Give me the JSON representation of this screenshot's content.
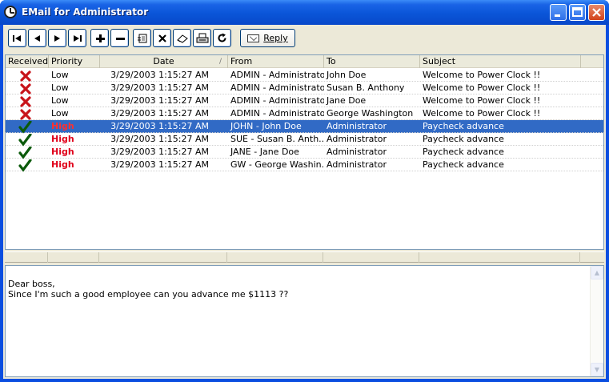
{
  "window": {
    "title": "EMail for Administrator"
  },
  "toolbar": {
    "first": "|◀",
    "prev": "◀",
    "next": "▶",
    "last": "▶|",
    "add": "+",
    "remove": "−",
    "edit": "✎",
    "delete": "✕",
    "clear": "◇",
    "print": "▤",
    "refresh": "↻",
    "reply_label": "Reply"
  },
  "columns": [
    "Received",
    "Priority",
    "Date",
    "From",
    "To",
    "Subject"
  ],
  "rows": [
    {
      "received": "unread",
      "priority": "Low",
      "date": "3/29/2003 1:15:27 AM",
      "from": "ADMIN - Administrator",
      "to": "John Doe",
      "subject": "Welcome to Power Clock !!"
    },
    {
      "received": "unread",
      "priority": "Low",
      "date": "3/29/2003 1:15:27 AM",
      "from": "ADMIN - Administrator",
      "to": "Susan B. Anthony",
      "subject": "Welcome to Power Clock !!"
    },
    {
      "received": "unread",
      "priority": "Low",
      "date": "3/29/2003 1:15:27 AM",
      "from": "ADMIN - Administrator",
      "to": "Jane Doe",
      "subject": "Welcome to Power Clock !!"
    },
    {
      "received": "unread",
      "priority": "Low",
      "date": "3/29/2003 1:15:27 AM",
      "from": "ADMIN - Administrator",
      "to": "George Washington",
      "subject": "Welcome to Power Clock !!"
    },
    {
      "received": "read",
      "priority": "High",
      "date": "3/29/2003 1:15:27 AM",
      "from": "JOHN - John Doe",
      "to": "Administrator",
      "subject": "Paycheck advance",
      "selected": true
    },
    {
      "received": "read",
      "priority": "High",
      "date": "3/29/2003 1:15:27 AM",
      "from": "SUE - Susan B. Anth...",
      "to": "Administrator",
      "subject": "Paycheck advance"
    },
    {
      "received": "read",
      "priority": "High",
      "date": "3/29/2003 1:15:27 AM",
      "from": "JANE - Jane Doe",
      "to": "Administrator",
      "subject": "Paycheck advance"
    },
    {
      "received": "read",
      "priority": "High",
      "date": "3/29/2003 1:15:27 AM",
      "from": "GW - George Washin...",
      "to": "Administrator",
      "subject": "Paycheck advance"
    }
  ],
  "message": {
    "lines": [
      "Dear boss,",
      "Since I'm such a good employee can you advance me $1113 ??"
    ]
  },
  "colors": {
    "selection": "#316ac5",
    "high_priority": "#e0001b",
    "unread_mark": "#c8141a",
    "read_mark": "#0b5a0b"
  }
}
